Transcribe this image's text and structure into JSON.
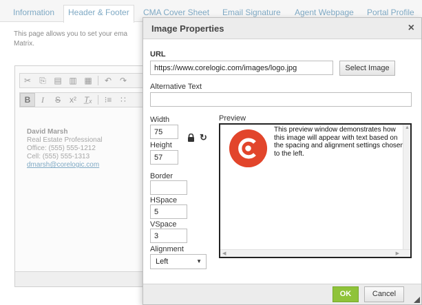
{
  "tabs": [
    {
      "label": "Information",
      "active": false
    },
    {
      "label": "Header & Footer",
      "active": true
    },
    {
      "label": "CMA Cover Sheet",
      "active": false
    },
    {
      "label": "Email Signature",
      "active": false
    },
    {
      "label": "Agent Webpage",
      "active": false
    },
    {
      "label": "Portal Profile",
      "active": false
    }
  ],
  "intro": {
    "line1": "This page allows you to set your ema",
    "line2": "Matrix."
  },
  "signature": {
    "name": "David Marsh",
    "title": "Real Estate Professional",
    "office": "Office: (555) 555-1212",
    "cell": "Cell: (555) 555-1313",
    "email": "dmarsh@corelogic.com"
  },
  "dialog": {
    "title": "Image Properties",
    "close_symbol": "×",
    "url_label": "URL",
    "url_value": "https://www.corelogic.com/images/logo.jpg",
    "select_image_label": "Select Image",
    "alt_label": "Alternative Text",
    "alt_value": "",
    "width_label": "Width",
    "width_value": "75",
    "height_label": "Height",
    "height_value": "57",
    "border_label": "Border",
    "border_value": "",
    "hspace_label": "HSpace",
    "hspace_value": "5",
    "vspace_label": "VSpace",
    "vspace_value": "3",
    "alignment_label": "Alignment",
    "alignment_value": "Left",
    "preview_label": "Preview",
    "preview_text": "This preview window demonstrates how this image will appear with text based on the spacing and alignment settings chosen to the left.",
    "ok_label": "OK",
    "cancel_label": "Cancel"
  },
  "icons": {
    "lock": "lock-icon",
    "reset_size": "reset-size-icon",
    "close": "close-icon",
    "logo": "corelogic-logo"
  },
  "colors": {
    "ok_button": "#8fc33a",
    "logo_red": "#e2452b",
    "tab_link": "#7fa9c4"
  }
}
